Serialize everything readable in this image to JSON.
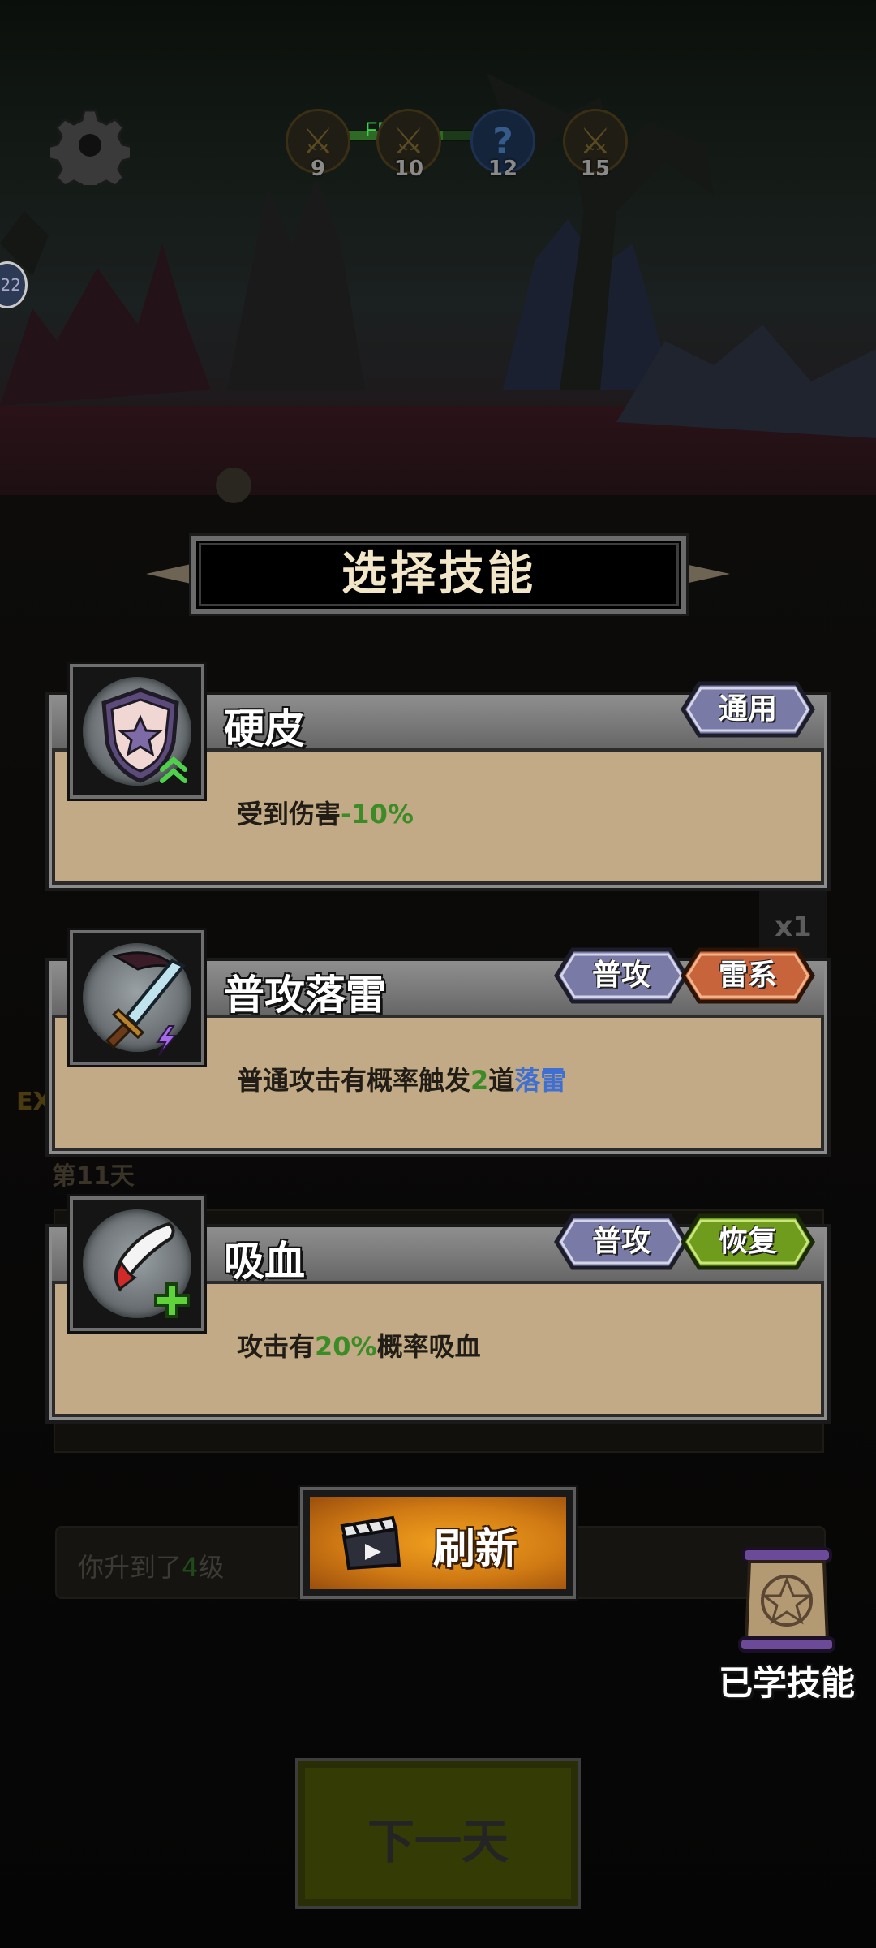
{
  "hud": {
    "fps_text": "FPS54",
    "stages": [
      {
        "number": "9",
        "icon": "sword-icon"
      },
      {
        "number": "10",
        "icon": "sword-icon"
      },
      {
        "number": "12",
        "icon": "question-icon",
        "glyph": "?"
      },
      {
        "number": "15",
        "icon": "sword-icon"
      }
    ],
    "side_bubble": "22"
  },
  "background": {
    "exp_label": "EX",
    "day_label": "第11天",
    "speed_label": "x1",
    "level_up": {
      "prefix": "你升到了",
      "level": "4",
      "suffix": "级"
    }
  },
  "dialog": {
    "title": "选择技能",
    "skills": [
      {
        "name": "硬皮",
        "icon": "shield-star-icon",
        "tags": [
          {
            "label": "通用",
            "color": "#7a7aa6"
          }
        ],
        "desc": {
          "text": "受到伤害",
          "highlight": "-10%"
        }
      },
      {
        "name": "普攻落雷",
        "icon": "lightning-sword-icon",
        "tags": [
          {
            "label": "普攻",
            "color": "#7a7aa6"
          },
          {
            "label": "雷系",
            "color": "#c8643c"
          }
        ],
        "desc": {
          "text": "普通攻击有概率触发",
          "number": "2",
          "mid": "道",
          "highlight": "落雷"
        }
      },
      {
        "name": "吸血",
        "icon": "blood-fang-icon",
        "tags": [
          {
            "label": "普攻",
            "color": "#7a7aa6"
          },
          {
            "label": "恢复",
            "color": "#6f9c1c"
          }
        ],
        "desc": {
          "prefix": "攻击有",
          "highlight": "20%",
          "suffix": "概率吸血"
        }
      }
    ],
    "refresh_label": "刷新",
    "learned_label": "已学技能"
  },
  "footer": {
    "next_day_label": "下一天"
  },
  "colors": {
    "card_bg": "#c1aa85",
    "green_highlight": "#3b8c26",
    "blue_highlight": "#3f6fd1",
    "fps_green": "#35d24a",
    "refresh_orange": "#f1a21e"
  }
}
